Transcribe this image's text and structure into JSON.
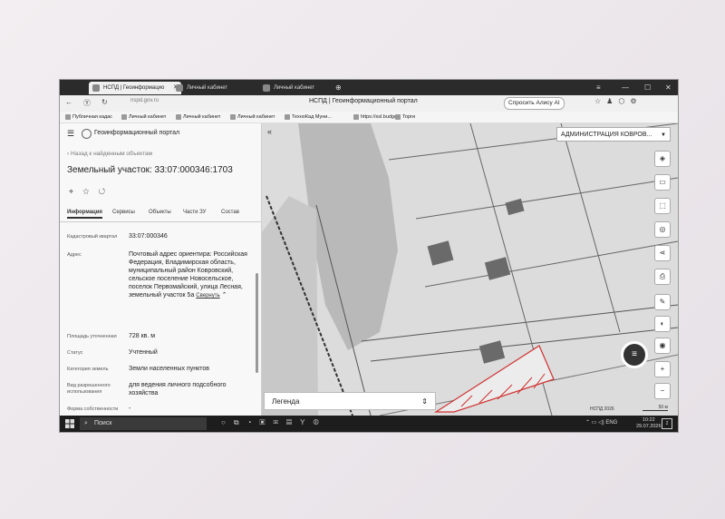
{
  "browser": {
    "tabs": [
      {
        "label": "НСПД | Геоинформацио",
        "active": true
      },
      {
        "label": "Личный кабинет",
        "active": false
      },
      {
        "label": "Личный кабинет",
        "active": false
      }
    ],
    "url": "nspd.gov.ru",
    "page_title": "НСПД | Геоинформационный портал",
    "alice_label": "Спросить Алису AI",
    "bookmarks": [
      "Публичная кадас",
      "Личный кабинет",
      "Личный кабинет",
      "Личный кабинет",
      "ТехноКад Муни...",
      "https://ssl.budge",
      "Торги"
    ]
  },
  "panel": {
    "portal_name": "Геоинформационный портал",
    "back_link": "Назад к найденным объектам",
    "title": "Земельный участок: 33:07:000346:1703",
    "tabs": [
      "Информация",
      "Сервисы",
      "Объекты",
      "Части ЗУ",
      "Состав"
    ],
    "fields": [
      {
        "label": "Кадастровый квартал",
        "value": "33:07:000346"
      },
      {
        "label": "Адрес",
        "value": "Почтовый адрес ориентира: Российская Федерация, Владимирская область, муниципальный район Ковровский, сельское поселение Новосельское, поселок Первомайский, улица Лесная, земельный участок 5а"
      },
      {
        "label": "Площадь уточненная",
        "value": "728 кв. м"
      },
      {
        "label": "Статус",
        "value": "Учтенный"
      },
      {
        "label": "Категория земель",
        "value": "Земли населенных пунктов"
      },
      {
        "label": "Вид разрешенного использования",
        "value": "для ведения личного подсобного хозяйства"
      },
      {
        "label": "Форма собственности",
        "value": "-"
      }
    ],
    "collapse_label": "Свернуть"
  },
  "map": {
    "admin_select": "АДМИНИСТРАЦИЯ КОВРОВ...",
    "legend_label": "Легенда",
    "copyright": "НСПД 2026",
    "scale_label": "50 м",
    "accent_color": "#d03030"
  },
  "taskbar": {
    "search_placeholder": "Поиск",
    "lang": "ENG",
    "time": "10:22",
    "date": "29.07.2026",
    "notifications": "2"
  }
}
